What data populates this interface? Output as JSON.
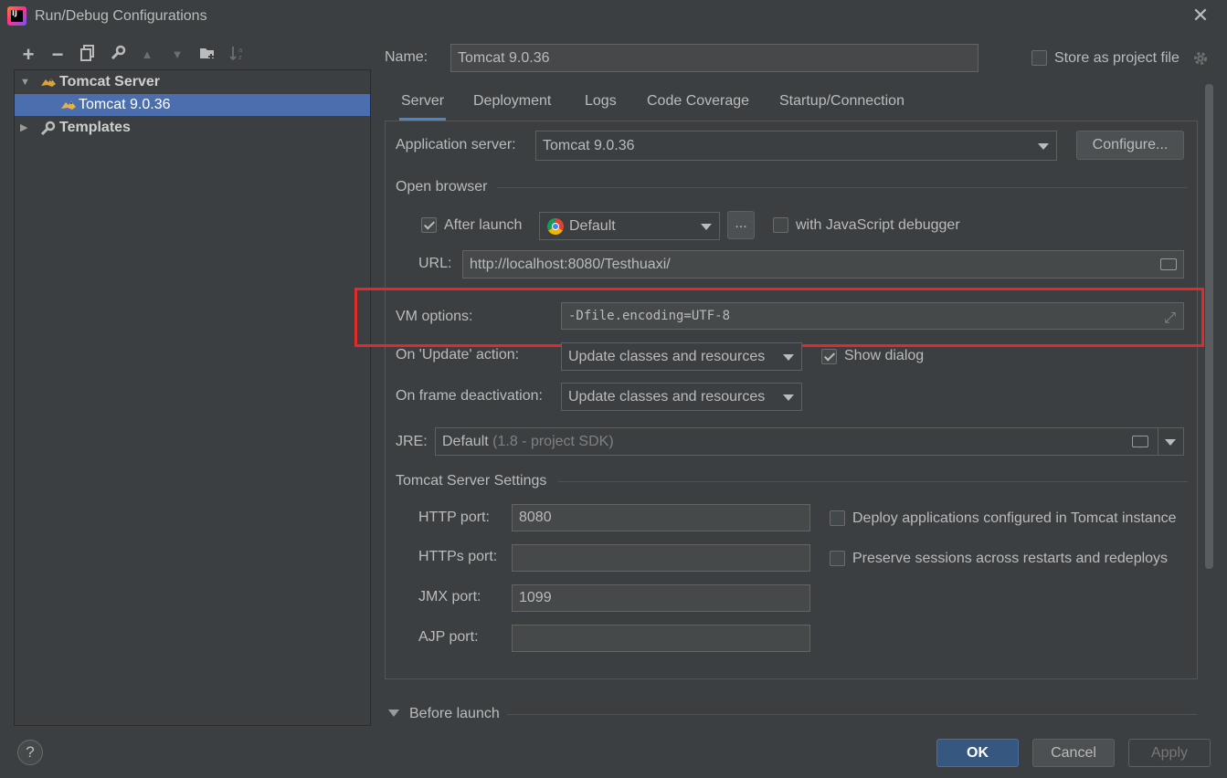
{
  "window": {
    "title": "Run/Debug Configurations",
    "app_icon_text": "IJ"
  },
  "toolbar": {
    "add": "+",
    "remove": "−",
    "copy_icon": "copy-icon",
    "edit_icon": "wrench-icon",
    "up": "▲",
    "down": "▼",
    "folder_icon": "new-folder-icon",
    "sort_icon": "sort-icon"
  },
  "tree": {
    "items": [
      {
        "label": "Tomcat Server",
        "expanded": true
      },
      {
        "label": "Tomcat 9.0.36",
        "selected": true
      },
      {
        "label": "Templates",
        "expanded": false
      }
    ]
  },
  "header": {
    "name_label": "Name:",
    "name_value": "Tomcat 9.0.36",
    "store_label": "Store as project file",
    "store_checked": false
  },
  "tabs": [
    {
      "label": "Server",
      "active": true
    },
    {
      "label": "Deployment"
    },
    {
      "label": "Logs"
    },
    {
      "label": "Code Coverage"
    },
    {
      "label": "Startup/Connection"
    }
  ],
  "server": {
    "app_server_label": "Application server:",
    "app_server_value": "Tomcat 9.0.36",
    "configure_button": "Configure...",
    "open_browser_title": "Open browser",
    "after_launch_label": "After launch",
    "after_launch_checked": true,
    "browser_value": "Default",
    "browser_more_button": "...",
    "js_debugger_label": "with JavaScript debugger",
    "js_debugger_checked": false,
    "url_label": "URL:",
    "url_value": "http://localhost:8080/Testhuaxi/",
    "vm_options_label": "VM options:",
    "vm_options_value": "-Dfile.encoding=UTF-8",
    "on_update_label": "On 'Update' action:",
    "on_update_value": "Update classes and resources",
    "show_dialog_label": "Show dialog",
    "show_dialog_checked": true,
    "on_frame_label": "On frame deactivation:",
    "on_frame_value": "Update classes and resources",
    "jre_label": "JRE:",
    "jre_value": "Default",
    "jre_hint": "(1.8 - project SDK)",
    "tomcat_settings_title": "Tomcat Server Settings",
    "http_port_label": "HTTP port:",
    "http_port_value": "8080",
    "https_port_label": "HTTPs port:",
    "https_port_value": "",
    "jmx_port_label": "JMX port:",
    "jmx_port_value": "1099",
    "ajp_port_label": "AJP port:",
    "ajp_port_value": "",
    "deploy_label": "Deploy applications configured in Tomcat instance",
    "deploy_checked": false,
    "preserve_label": "Preserve sessions across restarts and redeploys",
    "preserve_checked": false
  },
  "before_launch": {
    "label": "Before launch"
  },
  "footer": {
    "help": "?",
    "ok": "OK",
    "cancel": "Cancel",
    "apply": "Apply"
  },
  "colors": {
    "background": "#3c3f41",
    "selection": "#4b6eaf",
    "primary_button": "#365880",
    "highlight_border": "#e32a2a"
  }
}
